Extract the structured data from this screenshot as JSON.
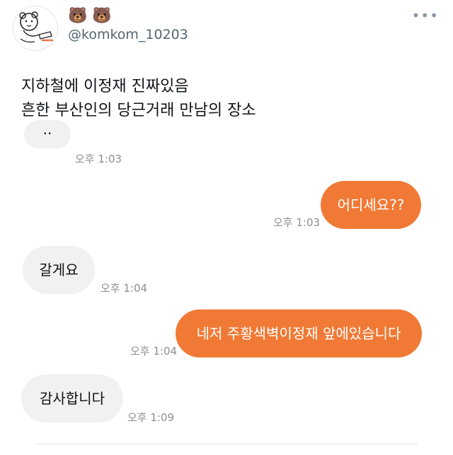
{
  "header": {
    "display_name": "🐻 🐻",
    "handle": "@komkom_10203",
    "more_label": "•••"
  },
  "tweet": {
    "line1": "지하철에 이정재 진짜있음",
    "line2": "흔한 부산인의 당근거래 만남의 장소"
  },
  "chat": {
    "messages": [
      {
        "side": "in",
        "text": "..",
        "time": "오후 1:03"
      },
      {
        "side": "out",
        "text": "어디세요??",
        "time": "오후 1:03"
      },
      {
        "side": "in",
        "text": "갈게요",
        "time": "오후 1:04"
      },
      {
        "side": "out",
        "text": "네저 주황색벽이정재 앞에있습니다",
        "time": "오후 1:04"
      },
      {
        "side": "in",
        "text": "감사합니다",
        "time": "오후 1:09"
      }
    ]
  },
  "colors": {
    "outgoing_bubble": "#f07a35",
    "incoming_bubble": "#f1f1f4",
    "timestamp": "#8e8e93"
  },
  "icons": {
    "avatar": "bear-sketch-avatar",
    "more": "more-horizontal-icon"
  }
}
